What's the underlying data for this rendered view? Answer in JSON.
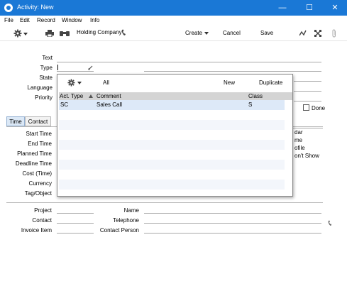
{
  "window": {
    "title": "Activity: New",
    "minimize": "—",
    "maximize": "☐",
    "close": "✕"
  },
  "menu": [
    "File",
    "Edit",
    "Record",
    "Window",
    "Info"
  ],
  "toolbar": {
    "company": "Holding Company",
    "create": "Create",
    "cancel": "Cancel",
    "save": "Save"
  },
  "form": {
    "text_label": "Text",
    "type_label": "Type",
    "state_label": "State",
    "language_label": "Language",
    "priority_label": "Priority",
    "done_label": "Done"
  },
  "tabs": {
    "time": "Time",
    "contact": "Contact"
  },
  "time_fields": [
    "Start Time",
    "End Time",
    "Planned Time",
    "Deadline Time",
    "Cost (Time)",
    "Currency",
    "Tag/Object"
  ],
  "right_partials": [
    "dar",
    "me",
    "ofile",
    "on't Show"
  ],
  "bottom": {
    "project_label": "Project",
    "contact_label": "Contact",
    "invoice_item_label": "Invoice Item",
    "name_label": "Name",
    "telephone_label": "Telephone",
    "contact_person_label": "Contact Person"
  },
  "popup": {
    "all": "All",
    "new": "New",
    "duplicate": "Duplicate",
    "columns": {
      "act_type": "Act. Type",
      "comment": "Comment",
      "class": "Class"
    },
    "rows": [
      {
        "act_type": "SC",
        "comment": "Sales Call",
        "class": "S"
      }
    ]
  },
  "colors": {
    "titlebar": "#1a78d6",
    "selected_row": "#dde9f8"
  }
}
